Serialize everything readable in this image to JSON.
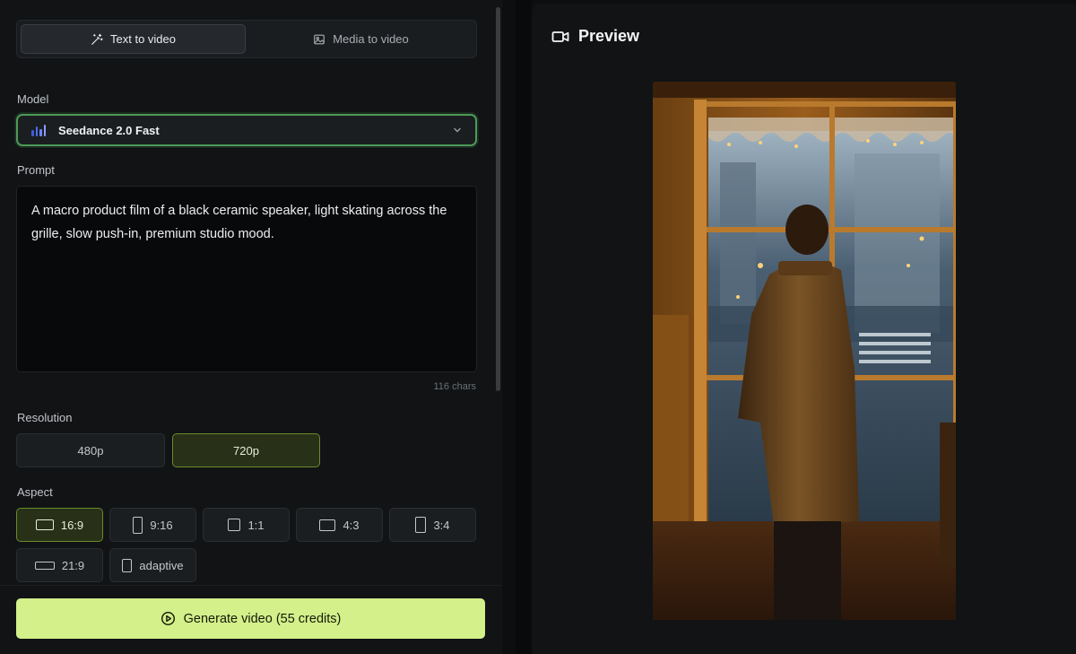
{
  "mode_tabs": [
    {
      "label": "Text to video",
      "icon": "magic-wand-icon",
      "active": true
    },
    {
      "label": "Media to video",
      "icon": "image-icon",
      "active": false
    }
  ],
  "model": {
    "label": "Model",
    "selected": "Seedance 2.0 Fast",
    "icon": "bar-chart-icon"
  },
  "prompt": {
    "label": "Prompt",
    "value": "A macro product film of a black ceramic speaker, light skating across the grille, slow push-in, premium studio mood.",
    "char_count": "116 chars"
  },
  "resolution": {
    "label": "Resolution",
    "options": [
      "480p",
      "720p"
    ],
    "selected": "720p"
  },
  "aspect": {
    "label": "Aspect",
    "options": [
      "16:9",
      "9:16",
      "1:1",
      "4:3",
      "3:4",
      "21:9",
      "adaptive"
    ],
    "selected": "16:9"
  },
  "generate": {
    "label": "Generate video (55 credits)",
    "icon": "play-circle-icon"
  },
  "preview": {
    "title": "Preview",
    "icon": "video-camera-icon"
  },
  "colors": {
    "accent": "#d3f08a",
    "selected_border": "#6b8a2a",
    "focus_border": "#4d9a56",
    "background": "#111315"
  }
}
